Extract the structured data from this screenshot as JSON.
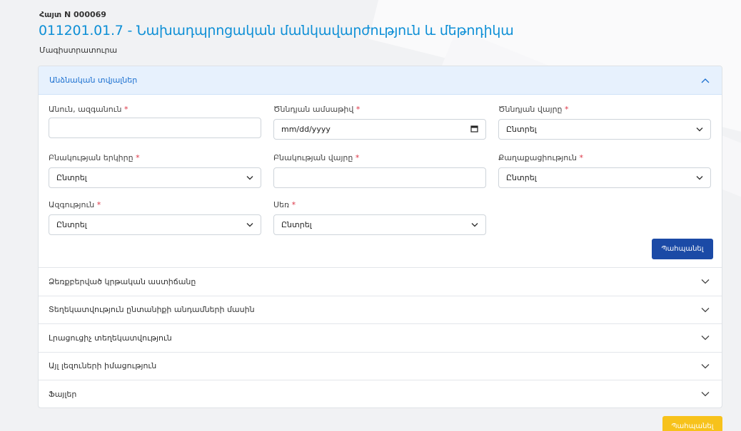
{
  "header": {
    "application_no": "Հայտ N 000069",
    "program_title": "011201.01.7 - Նախադպրոցական մանկավարժություն և մեթոդիկա",
    "program_level": "Մագիստրատուրա"
  },
  "personal": {
    "section_title": "Անձնական տվյալներ",
    "fields": {
      "name": {
        "label": "Անուն, ազգանուն",
        "value": ""
      },
      "birth_date": {
        "label": "Ծննդյան ամսաթիվ",
        "placeholder": "mm/dd/yyyy"
      },
      "birth_place": {
        "label": "Ծննդյան վայրը",
        "value": "Ընտրել"
      },
      "residence_country": {
        "label": "Բնակության երկիրը",
        "value": "Ընտրել"
      },
      "residence_place": {
        "label": "Բնակության վայրը",
        "value": ""
      },
      "citizenship": {
        "label": "Քաղաքացիություն",
        "value": "Ընտրել"
      },
      "nationality": {
        "label": "Ազգություն",
        "value": "Ընտրել"
      },
      "gender": {
        "label": "Սեռ",
        "value": "Ընտրել"
      }
    },
    "required_mark": "*",
    "save_label": "Պահպանել"
  },
  "sections": [
    {
      "label": "Ձեռքբերված կրթական աստիճանը"
    },
    {
      "label": "Տեղեկատվություն ընտանիքի անդամների մասին"
    },
    {
      "label": "Լրացուցիչ տեղեկատվություն"
    },
    {
      "label": "Այլ լեզուների իմացություն"
    },
    {
      "label": "Ֆայլեր"
    }
  ],
  "submit_label": "Պահպանել",
  "colors": {
    "accent": "#0d8fd6",
    "primary_button": "#1b4aa6",
    "submit_button": "#f7c21b",
    "required": "#dc3545"
  }
}
